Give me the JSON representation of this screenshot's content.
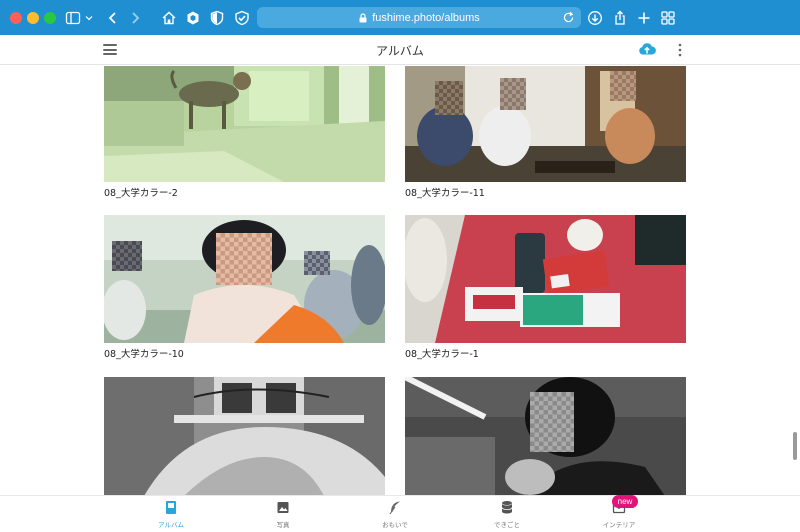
{
  "browser": {
    "url": "fushime.photo/albums",
    "icons": [
      "sidebar-icon",
      "chevron-down-icon",
      "back-icon",
      "forward-icon",
      "home-icon",
      "hexagon-icon",
      "shield-icon",
      "check-shield-icon",
      "lock-icon",
      "reload-icon",
      "download-icon",
      "share-icon",
      "plus-icon",
      "tabs-grid-icon"
    ]
  },
  "header": {
    "title": "アルバム",
    "icons": [
      "hamburger-menu-icon",
      "cloud-upload-icon",
      "more-vertical-icon"
    ]
  },
  "albums": [
    {
      "caption": "08_大学カラー-2"
    },
    {
      "caption": "08_大学カラー-11"
    },
    {
      "caption": "08_大学カラー-10"
    },
    {
      "caption": "08_大学カラー-1"
    },
    {
      "caption": ""
    },
    {
      "caption": ""
    }
  ],
  "tabs": [
    {
      "label": "アルバム",
      "icon": "album-icon",
      "active": true
    },
    {
      "label": "写真",
      "icon": "photo-icon",
      "active": false
    },
    {
      "label": "おもいで",
      "icon": "feather-icon",
      "active": false
    },
    {
      "label": "できごと",
      "icon": "database-icon",
      "active": false
    },
    {
      "label": "インテリア",
      "icon": "interior-frame-icon",
      "active": false
    }
  ],
  "badge": {
    "text": "new"
  },
  "colors": {
    "chrome": "#1f8fd1",
    "accent": "#29a6d9",
    "badge": "#e4137a"
  }
}
